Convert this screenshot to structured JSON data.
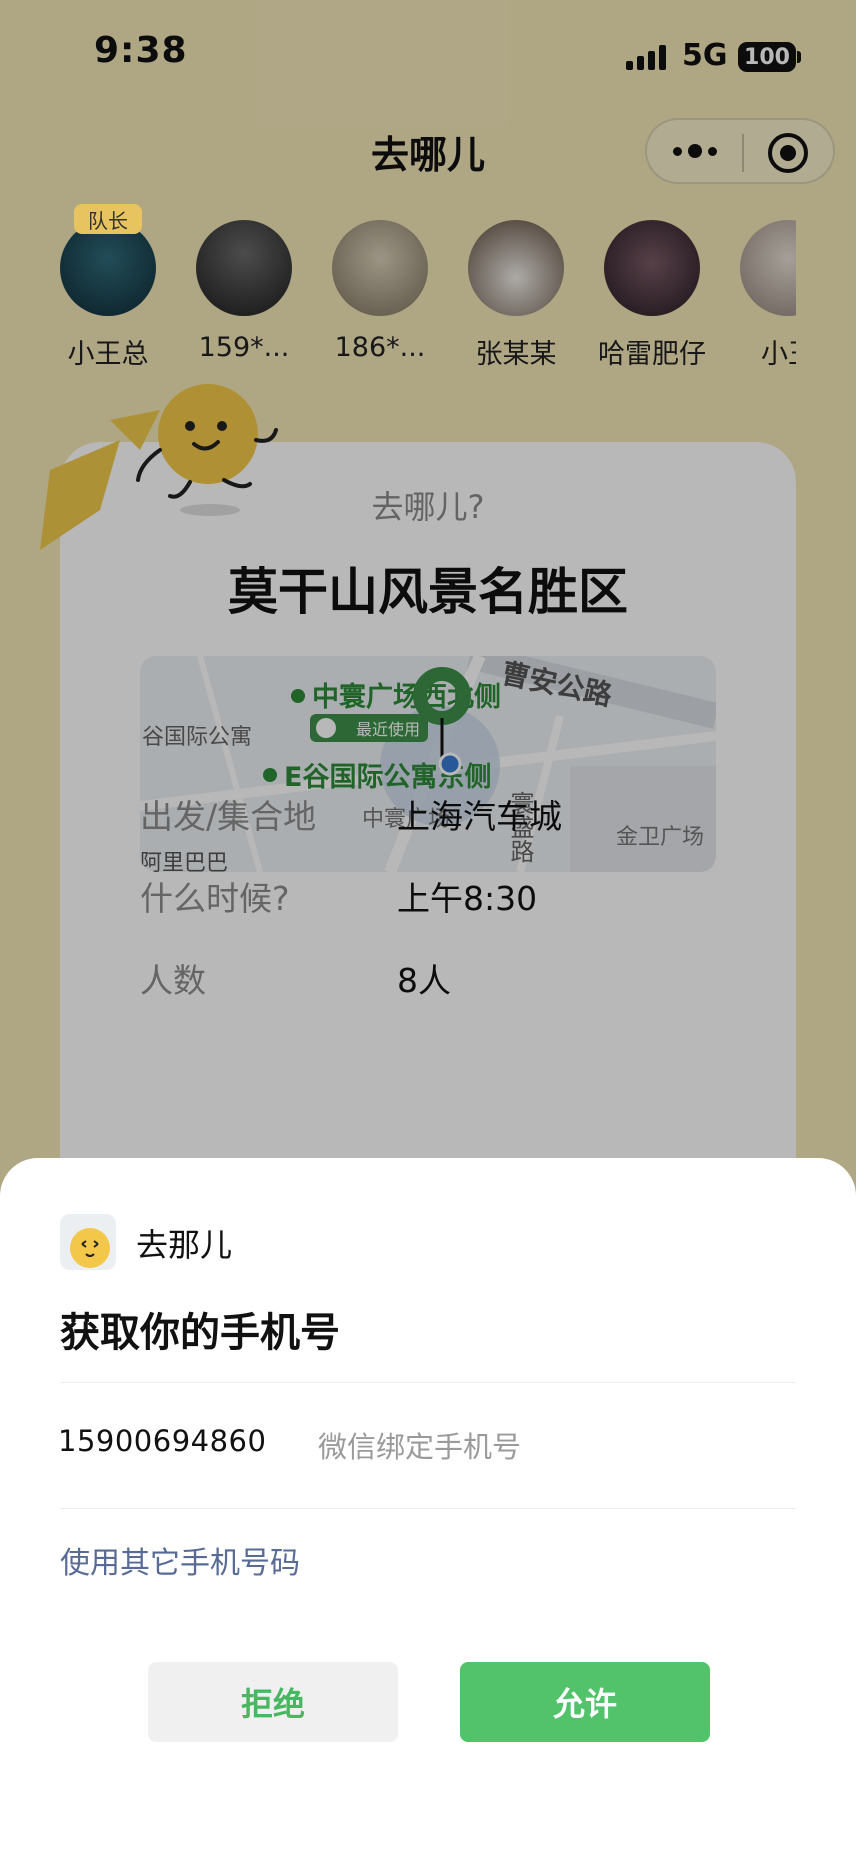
{
  "status_bar": {
    "time": "9:38",
    "network": "5G",
    "battery": "100"
  },
  "nav": {
    "title": "去哪儿"
  },
  "members": [
    {
      "name": "小王总",
      "badge": "队长",
      "color": "#1e3a4a"
    },
    {
      "name": "159*...",
      "color": "#2d2d2d"
    },
    {
      "name": "186*...",
      "color": "#a89c83"
    },
    {
      "name": "张某某",
      "color": "#6b5a4a"
    },
    {
      "name": "哈雷肥仔",
      "color": "#3a2a35"
    },
    {
      "name": "小王",
      "color": "#b0a59a"
    }
  ],
  "card": {
    "question": "去哪儿?",
    "destination": "莫干山风景名胜区",
    "map": {
      "road_top": "曹安公路",
      "poi_1": "中寰广场西北侧",
      "poi_2": "E谷国际公寓东侧",
      "recent_tag": "最近使用",
      "left_text": "谷国际公寓",
      "plaza": "中寰广场",
      "road_vertical": "寰盛路",
      "right_text": "金卫广场",
      "bottom_text": "阿里巴巴"
    },
    "rows": [
      {
        "label": "出发/集合地",
        "value": "上海汽车城"
      },
      {
        "label": "什么时候?",
        "value": "上午8:30"
      },
      {
        "label": "人数",
        "value": "8人"
      }
    ]
  },
  "sheet": {
    "app_name": "去那儿",
    "title": "获取你的手机号",
    "phone_number": "15900694860",
    "phone_desc": "微信绑定手机号",
    "other_link": "使用其它手机号码",
    "reject_label": "拒绝",
    "allow_label": "允许"
  },
  "colors": {
    "accent_green": "#52c36b",
    "link_blue": "#576b95",
    "map_green": "#2e8b3a"
  }
}
